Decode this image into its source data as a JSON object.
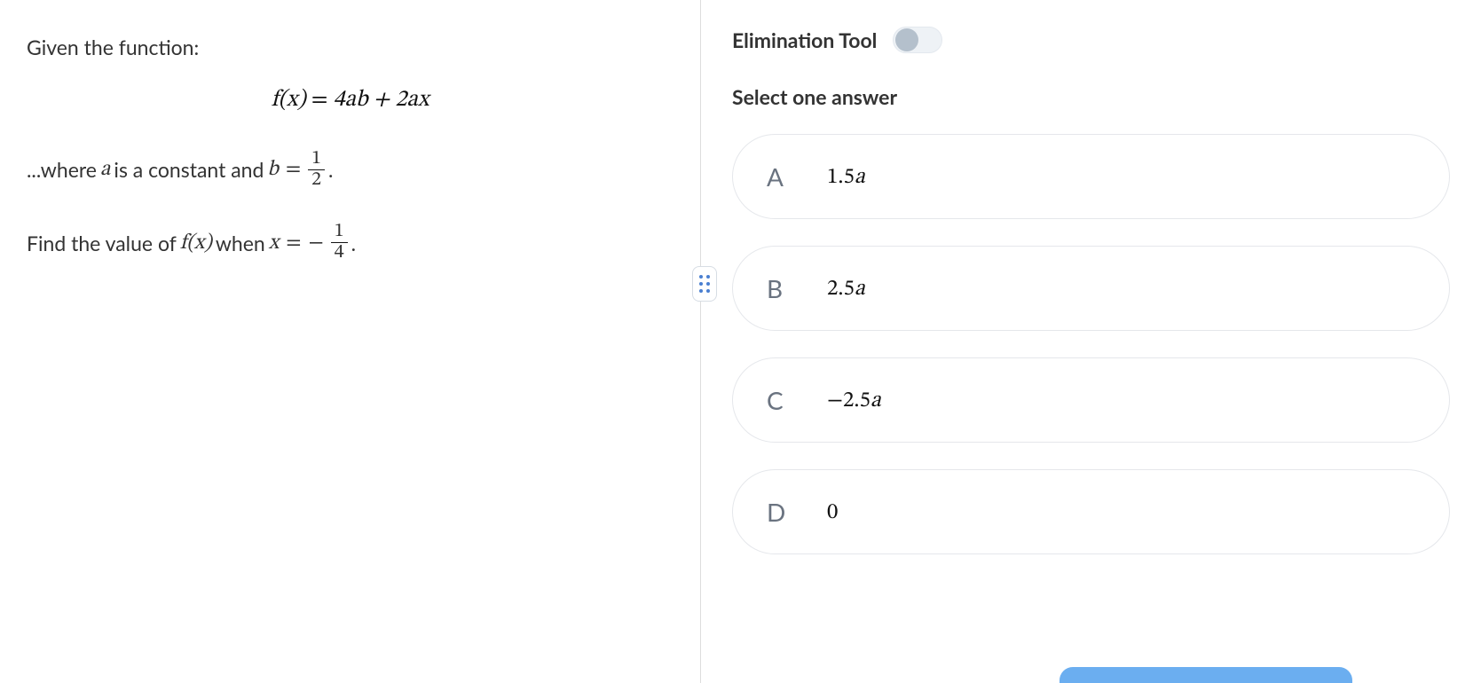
{
  "question": {
    "intro": "Given the function:",
    "equation_left": "f(x)",
    "equation_eqsym": " = ",
    "equation_right": "4ab + 2ax",
    "where_prefix": "...where ",
    "var_a": "a",
    "where_mid": " is a constant and ",
    "var_b": "b",
    "eq_sym": " = ",
    "b_frac_num": "1",
    "b_frac_den": "2",
    "period": ".",
    "find_prefix": "Find the value of ",
    "fx": "f(x)",
    "when_text": " when ",
    "var_x": "x",
    "neg_sign": "−",
    "x_frac_num": "1",
    "x_frac_den": "4"
  },
  "right": {
    "tool_label": "Elimination Tool",
    "select_label": "Select one answer"
  },
  "answers": [
    {
      "letter": "A",
      "value_num": "1.5",
      "value_var": "a"
    },
    {
      "letter": "B",
      "value_num": "2.5",
      "value_var": "a"
    },
    {
      "letter": "C",
      "value_num": "−2.5",
      "value_var": "a"
    },
    {
      "letter": "D",
      "value_num": "0",
      "value_var": ""
    }
  ]
}
